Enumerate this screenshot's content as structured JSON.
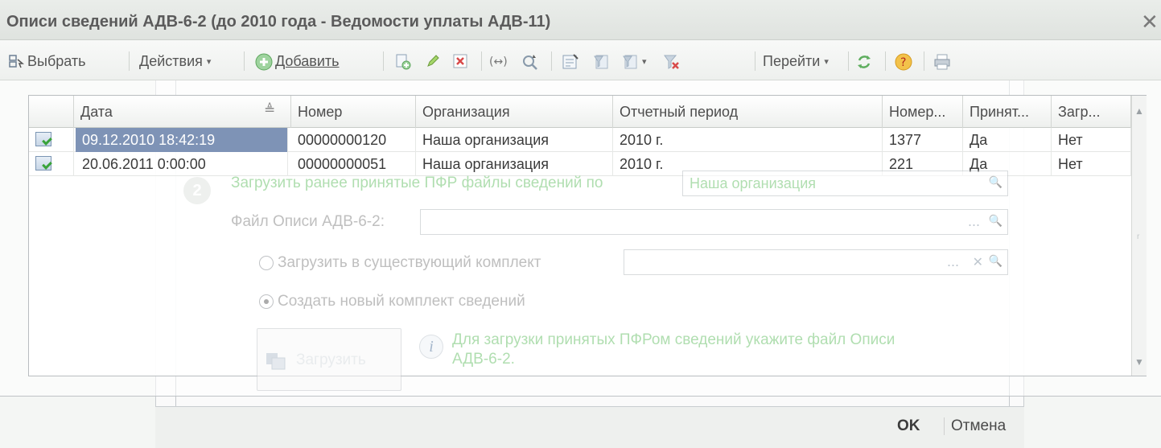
{
  "window": {
    "title": "Описи сведений АДВ-6-2 (до 2010 года - Ведомости уплаты АДВ-11)",
    "close_glyph": "✕"
  },
  "toolbar": {
    "select_label": "Выбрать",
    "actions_label": "Действия",
    "add_label": "Добавить",
    "goto_label": "Перейти",
    "dropdown_glyph": "▾"
  },
  "table": {
    "columns": [
      "Дата",
      "Номер",
      "Организация",
      "Отчетный период",
      "Номер...",
      "Принят...",
      "Загр..."
    ],
    "sort_glyph": "≜",
    "rows": [
      {
        "date": "09.12.2010 18:42:19",
        "number": "00000000120",
        "org": "Наша организация",
        "period": "2010 г.",
        "num2": "1377",
        "accepted": "Да",
        "loaded": "Нет"
      },
      {
        "date": "20.06.2011 0:00:00",
        "number": "00000000051",
        "org": "Наша организация",
        "period": "2010 г.",
        "num2": "221",
        "accepted": "Да",
        "loaded": "Нет"
      }
    ],
    "scroll_up": "▲",
    "scroll_down": "▼",
    "scroll_mid": "r"
  },
  "ghost_form": {
    "step_number": "2",
    "load_prev_label": "Загрузить ранее принятые ПФР файлы сведений по",
    "org_value": "Наша организация",
    "file_label": "Файл Описи АДВ-6-2:",
    "radio_existing_label": "Загрузить в существующий комплект",
    "radio_new_label": "Создать новый комплект сведений",
    "load_button_label": "Загрузить",
    "info_line1": "Для загрузки принятых ПФРом сведений укажите файл Описи",
    "info_line2": "АДВ-6-2.",
    "info_glyph": "i",
    "ellipsis": "...",
    "clear_glyph": "✕",
    "search_glyph": "🔍",
    "ok_label": "OK",
    "cancel_label": "Отмена"
  },
  "colors": {
    "selection": "#7e93b6",
    "ghost_green": "#6fc36f"
  }
}
